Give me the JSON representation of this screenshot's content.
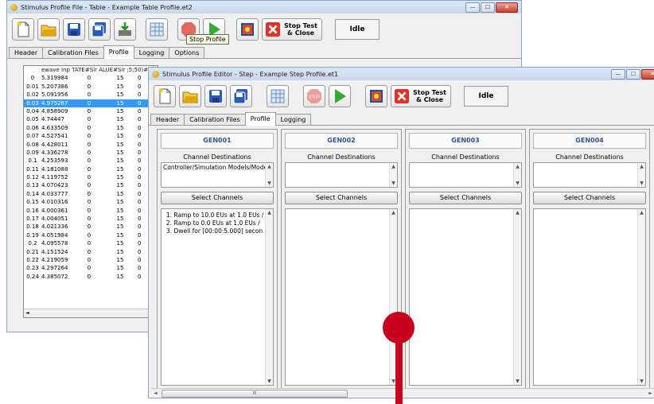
{
  "back_window": {
    "title": "Stimulus Profile File - Table - Example Table Profile.et2",
    "toolbar": {
      "icons": [
        "new-file-icon",
        "open-folder-icon",
        "save-icon",
        "save-all-icon",
        "export-icon",
        "table-icon",
        "stop-icon",
        "play-icon",
        "select-channels-icon",
        "stop-close-icon"
      ],
      "tooltip": "Stop Profile",
      "stop_test_close": "Stop Test\n& Close",
      "status": "Idle"
    },
    "tabs": [
      "Header",
      "Calibration Files",
      "Profile",
      "Logging",
      "Options"
    ],
    "active_tab": "Profile",
    "table_header": "ewave Inp TATE#Sir ALUE#Sir ;5;50)#Si",
    "rows": [
      [
        "0",
        "5.319984",
        "0",
        "15",
        "0"
      ],
      [
        "0.01",
        "5.207386",
        "0",
        "15",
        "0"
      ],
      [
        "0.02",
        "5.091956",
        "0",
        "15",
        "0"
      ],
      [
        "0.03",
        "4.975267",
        "0",
        "15",
        "0"
      ],
      [
        "0.04",
        "4.858909",
        "0",
        "15",
        "0"
      ],
      [
        "0.05",
        "4.74447",
        "0",
        "15",
        "0"
      ],
      [
        "0.06",
        "4.633509",
        "0",
        "15",
        "0"
      ],
      [
        "0.07",
        "4.527541",
        "0",
        "15",
        "0"
      ],
      [
        "0.08",
        "4.428011",
        "0",
        "15",
        "0"
      ],
      [
        "0.09",
        "4.336278",
        "0",
        "15",
        "0"
      ],
      [
        "0.1",
        "4.253593",
        "0",
        "15",
        "0"
      ],
      [
        "0.11",
        "4.181088",
        "0",
        "15",
        "0"
      ],
      [
        "0.12",
        "4.119752",
        "0",
        "15",
        "0"
      ],
      [
        "0.13",
        "4.070423",
        "0",
        "15",
        "0"
      ],
      [
        "0.14",
        "4.033777",
        "0",
        "15",
        "0"
      ],
      [
        "0.15",
        "4.010316",
        "0",
        "15",
        "0"
      ],
      [
        "0.16",
        "4.000361",
        "0",
        "15",
        "0"
      ],
      [
        "0.17",
        "4.004051",
        "0",
        "15",
        "0"
      ],
      [
        "0.18",
        "4.021336",
        "0",
        "15",
        "0"
      ],
      [
        "0.19",
        "4.051984",
        "0",
        "15",
        "0"
      ],
      [
        "0.2",
        "4.095578",
        "0",
        "15",
        "0"
      ],
      [
        "0.21",
        "4.151524",
        "0",
        "15",
        "0"
      ],
      [
        "0.22",
        "4.219059",
        "0",
        "15",
        "0"
      ],
      [
        "0.23",
        "4.297264",
        "0",
        "15",
        "0"
      ],
      [
        "0.24",
        "4.385072",
        "0",
        "15",
        "0"
      ]
    ],
    "selected_row": "0.03"
  },
  "front_window": {
    "title": "Stimulus Profile Editor - Step - Example Step Profile.et1",
    "toolbar": {
      "icons": [
        "new-file-icon",
        "open-folder-icon",
        "save-icon",
        "save-all-icon",
        "table-icon",
        "stop-icon",
        "play-icon",
        "select-channels-icon",
        "stop-close-icon"
      ],
      "stop_label": "STOP",
      "stop_test_close": "Stop Test\n& Close",
      "status": "Idle"
    },
    "tabs": [
      "Header",
      "Calibration Files",
      "Profile",
      "Logging"
    ],
    "active_tab": "Profile",
    "channel_destinations_label": "Channel Destinations",
    "select_channels_label": "Select Channels",
    "generators": [
      {
        "name": "GEN001",
        "destination": "Controller/Simulation Models/Model:",
        "steps": [
          "1.  Ramp to 10.0 EUs at 1.0 EUs /",
          "2.  Ramp to 0.0 EUs at 1.0 EUs /",
          "3.  Dwell for [00:00:5.000] secon"
        ]
      },
      {
        "name": "GEN002",
        "destination": "",
        "steps": []
      },
      {
        "name": "GEN003",
        "destination": "",
        "steps": []
      },
      {
        "name": "GEN004",
        "destination": "",
        "steps": []
      }
    ],
    "hscroll_grip": "III"
  },
  "colors": {
    "title_gradient": "#c6d8ee",
    "selection": "#3399ff",
    "gen_text": "#2f5496",
    "pin": "#c8001e",
    "close_button": "#c8412e"
  }
}
